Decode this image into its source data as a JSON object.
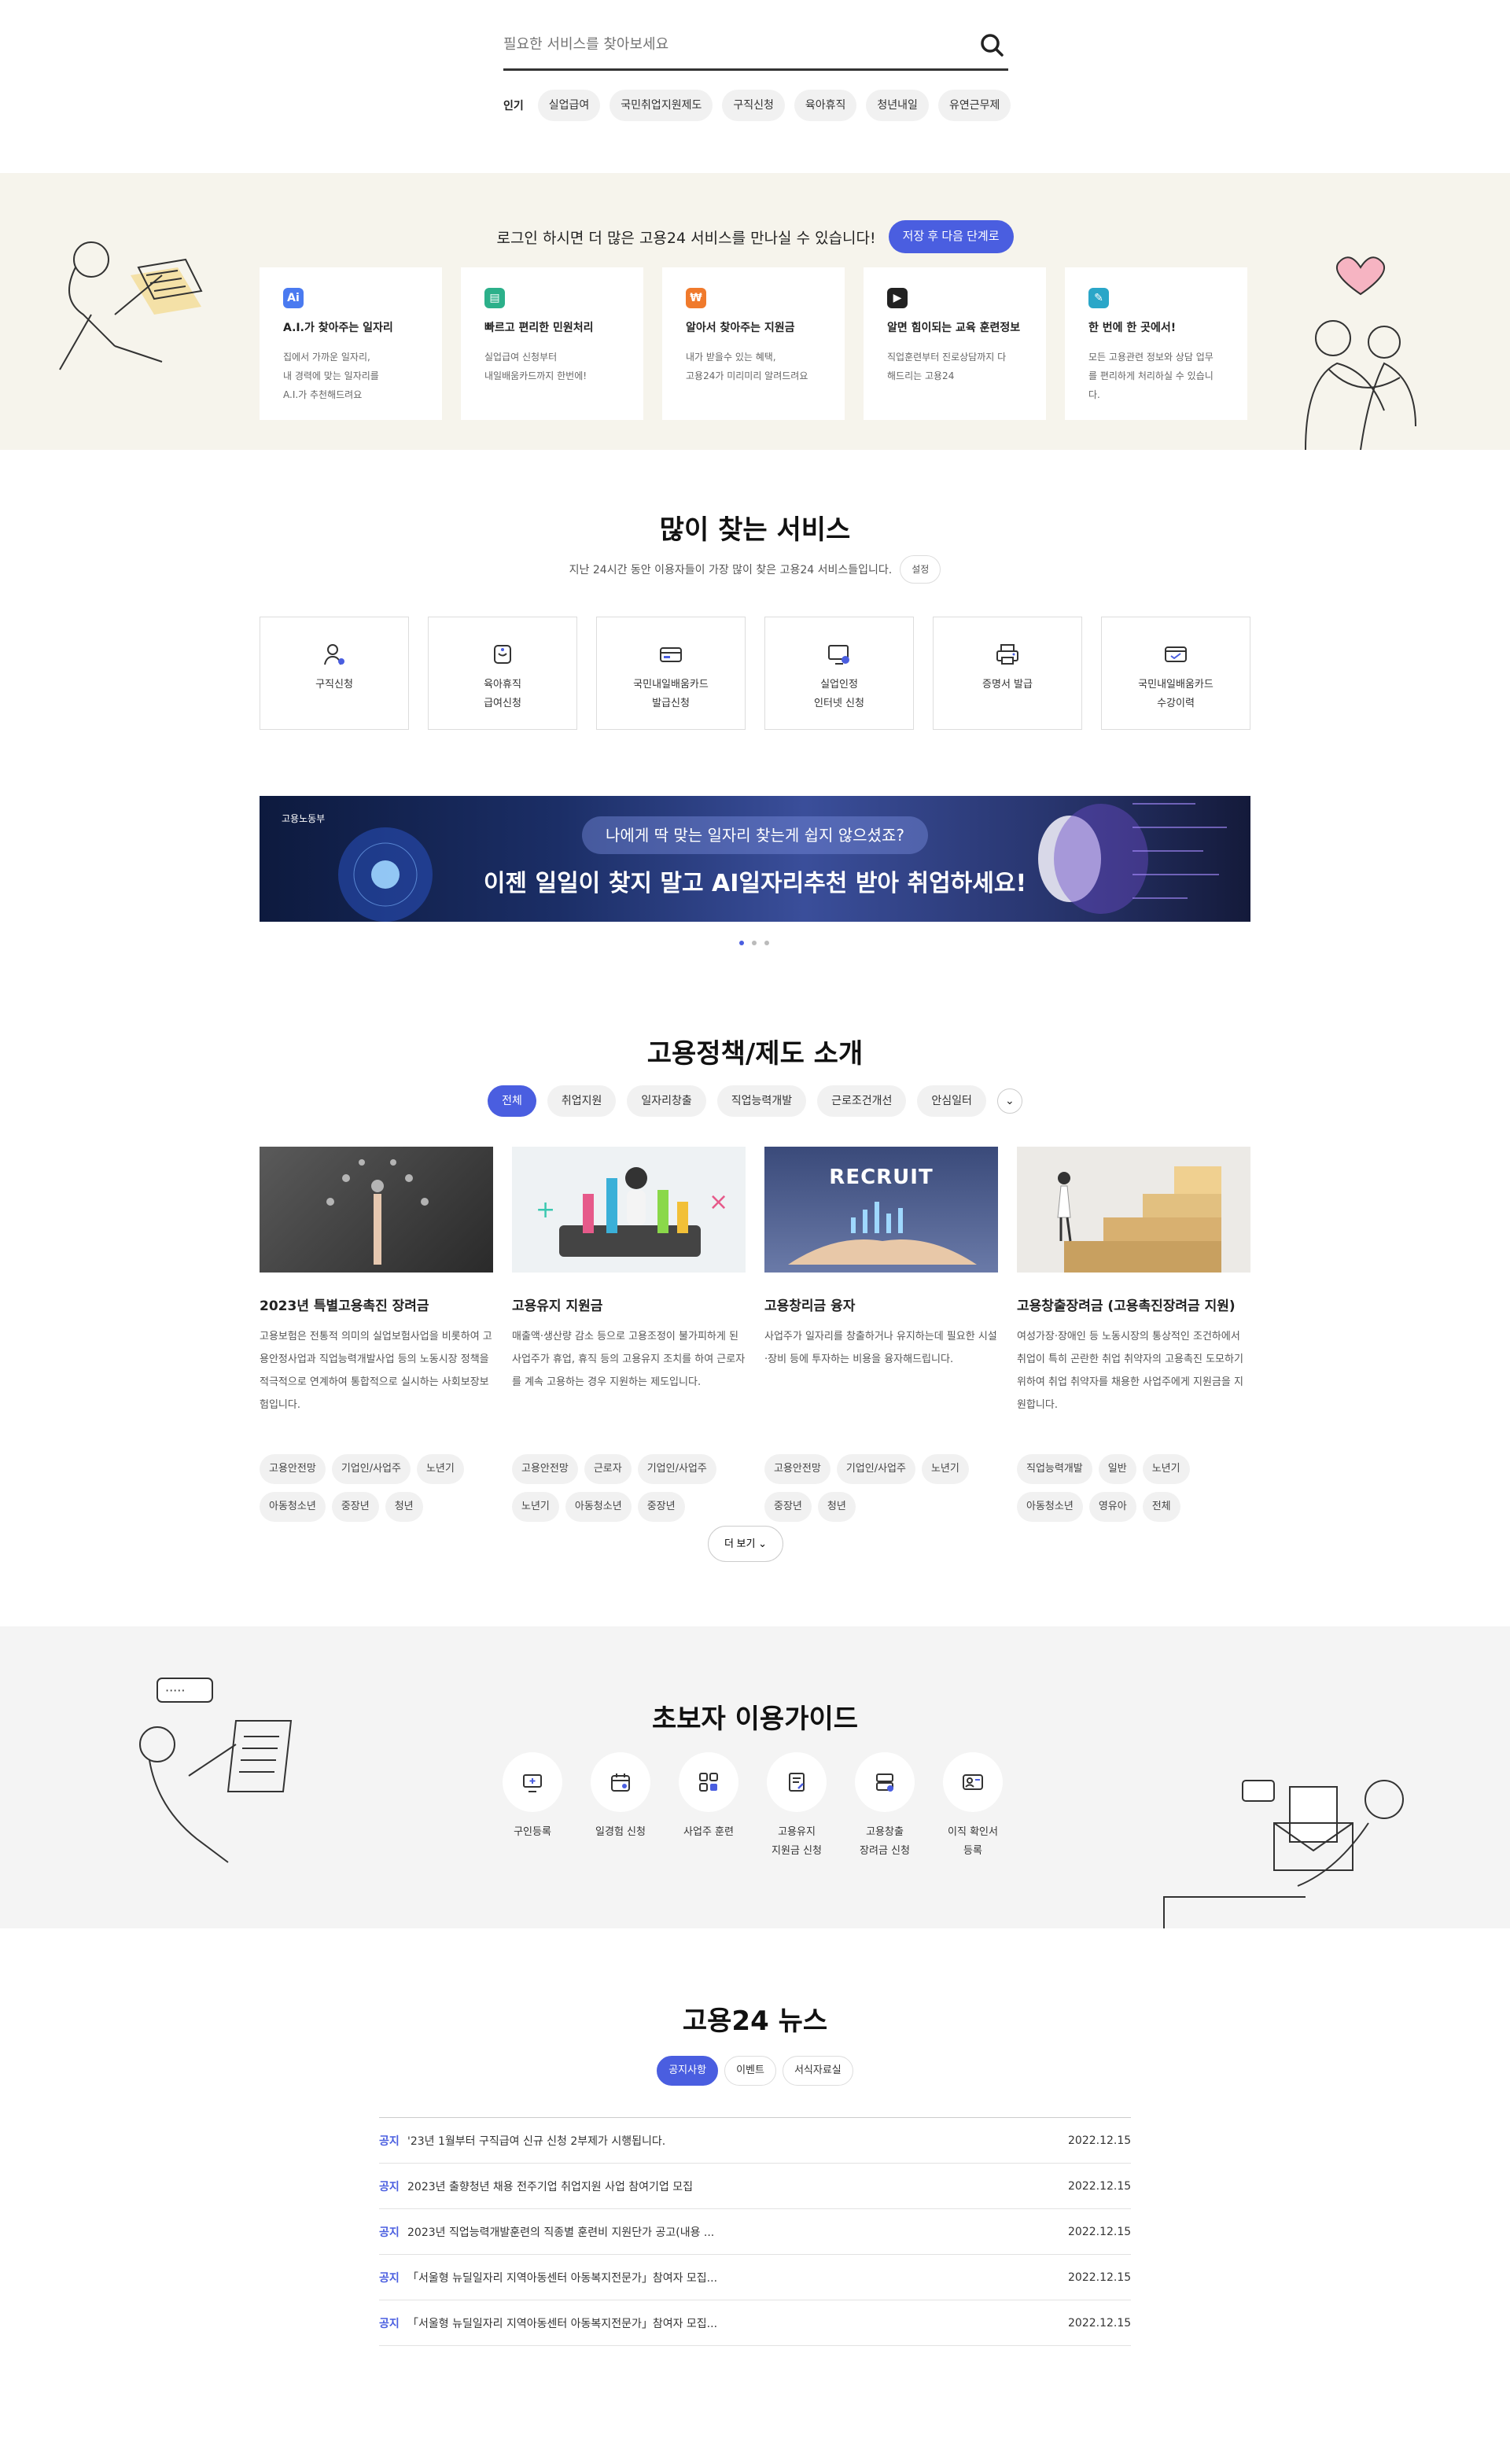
{
  "search": {
    "placeholder": "필요한 서비스를 찾아보세요",
    "popular_label": "인기",
    "chips": [
      "실업급여",
      "국민취업지원제도",
      "구직신청",
      "육아휴직",
      "청년내일",
      "유연근무제"
    ]
  },
  "login": {
    "message": "로그인 하시면 더 많은 고용24 서비스를 만나실 수 있습니다!",
    "button": "저장 후 다음 단계로",
    "cards": [
      {
        "icon": "ai-icon",
        "badge": "Ai",
        "color": "#4a7af0",
        "title": "A.I.가 찾아주는 일자리",
        "lines": [
          "집에서 가까운 일자리,",
          "내 경력에 맞는 일자리를",
          "A.I.가 추천해드려요"
        ]
      },
      {
        "icon": "document-icon",
        "badge": "▤",
        "color": "#2cb08a",
        "title": "빠르고 편리한 민원처리",
        "lines": [
          "실업급여 신청부터",
          "내일배움카드까지 한번에!"
        ]
      },
      {
        "icon": "coin-icon",
        "badge": "₩",
        "color": "#f07a2c",
        "title": "알아서 찾아주는 지원금",
        "lines": [
          "내가 받을수 있는 혜택,",
          "고용24가 미리미리 알려드려요"
        ]
      },
      {
        "icon": "play-icon",
        "badge": "▶",
        "color": "#222",
        "title": "알면 힘이되는 교육 훈련정보",
        "lines": [
          "직업훈련부터 진로상담까지 다",
          "해드리는 고용24"
        ]
      },
      {
        "icon": "pencil-icon",
        "badge": "✎",
        "color": "#2aa6c8",
        "title": "한 번에 한 곳에서!",
        "lines": [
          "모든 고용관련 정보와 상담 업무",
          "를 편리하게 처리하실 수 있습니",
          "다."
        ]
      }
    ]
  },
  "popular": {
    "title": "많이 찾는 서비스",
    "subtitle": "지난 24시간 동안 이용자들이 가장 많이 찾은 고용24 서비스들입니다.",
    "settings": "설정",
    "services": [
      {
        "icon": "person-icon",
        "label": "구직신청"
      },
      {
        "icon": "baby-icon",
        "label": "육아휴직\n급여신청"
      },
      {
        "icon": "card-icon",
        "label": "국민내일배움카드\n발급신청"
      },
      {
        "icon": "monitor-icon",
        "label": "실업인정\n인터넷 신청"
      },
      {
        "icon": "printer-icon",
        "label": "증명서 발급"
      },
      {
        "icon": "card-check-icon",
        "label": "국민내일배움카드\n수강이력"
      }
    ]
  },
  "banner": {
    "ministry": "고용노동부",
    "question": "나에게 딱 맞는 일자리 찾는게 쉽지 않으셨죠?",
    "headline": "이젠 일일이 찾지 말고 AI일자리추천 받아 취업하세요!"
  },
  "policy": {
    "title": "고용정책/제도 소개",
    "tabs": [
      "전체",
      "취업지원",
      "일자리창출",
      "직업능력개발",
      "근로조건개선",
      "안심일터"
    ],
    "cards": [
      {
        "title": "2023년 특별고용촉진 장려금",
        "desc": "고용보험은 전통적 의미의 실업보험사업을 비롯하여 고용안정사업과 직업능력개발사업 등의 노동시장 정책을 적극적으로 연계하여 통합적으로 실시하는 사회보장보험입니다.",
        "tags": [
          "고용안전망",
          "기업인/사업주",
          "노년기",
          "아동청소년",
          "중장년",
          "청년"
        ],
        "img": "business"
      },
      {
        "title": "고용유지 지원금",
        "desc": "매출액·생산량 감소 등으로 고용조정이 불가피하게 된 사업주가 휴업, 휴직 등의 고용유지 조치를 하여 근로자를 계속 고용하는 경우 지원하는 제도입니다.",
        "tags": [
          "고용안전망",
          "근로자",
          "기업인/사업주",
          "노년기",
          "아동청소년",
          "중장년"
        ],
        "img": "chart"
      },
      {
        "title": "고용창리금 융자",
        "desc": "사업주가 일자리를 창출하거나 유지하는데 필요한 시설·장비 등에 투자하는 비용을 융자해드립니다.",
        "tags": [
          "고용안전망",
          "기업인/사업주",
          "노년기",
          "중장년",
          "청년"
        ],
        "img": "recruit"
      },
      {
        "title": "고용창출장려금 (고용촉진장려금 지원)",
        "desc": "여성가장·장애인 등 노동시장의 통상적인 조건하에서 취업이 특히 곤란한 취업 취약자의 고용촉진 도모하기 위하여 취업 취약자를 채용한 사업주에게 지원금을 지원합니다.",
        "tags": [
          "직업능력개발",
          "일반",
          "노년기",
          "아동청소년",
          "영유아",
          "전체"
        ],
        "img": "steps"
      }
    ],
    "recruit_text": "RECRUIT",
    "more": "더 보기"
  },
  "guide": {
    "title": "초보자 이용가이드",
    "items": [
      {
        "icon": "monitor-add-icon",
        "label": "구인등록"
      },
      {
        "icon": "calendar-icon",
        "label": "일경험 신청"
      },
      {
        "icon": "grid-icon",
        "label": "사업주 훈련"
      },
      {
        "icon": "note-icon",
        "label": "고용유지\n지원금 신청"
      },
      {
        "icon": "stack-icon",
        "label": "고용창출\n장려금 신청"
      },
      {
        "icon": "id-card-icon",
        "label": "이직 확인서\n등록"
      }
    ]
  },
  "news": {
    "title": "고용24 뉴스",
    "tabs": [
      "공지사항",
      "이벤트",
      "서식자료실"
    ],
    "rows": [
      {
        "cat": "공지",
        "title": "'23년 1월부터 구직급여 신규 신청 2부제가 시행됩니다.",
        "date": "2022.12.15"
      },
      {
        "cat": "공지",
        "title": "2023년 출향청년 채용 전주기업 취업지원 사업 참여기업 모집",
        "date": "2022.12.15"
      },
      {
        "cat": "공지",
        "title": "2023년 직업능력개발훈련의 직종별 훈련비 지원단가 공고(내용 ...",
        "date": "2022.12.15"
      },
      {
        "cat": "공지",
        "title": "「서울형 뉴딜일자리 지역아동센터 아동복지전문가」참여자 모집...",
        "date": "2022.12.15"
      },
      {
        "cat": "공지",
        "title": "「서울형 뉴딜일자리 지역아동센터 아동복지전문가」참여자 모집...",
        "date": "2022.12.15"
      }
    ]
  }
}
